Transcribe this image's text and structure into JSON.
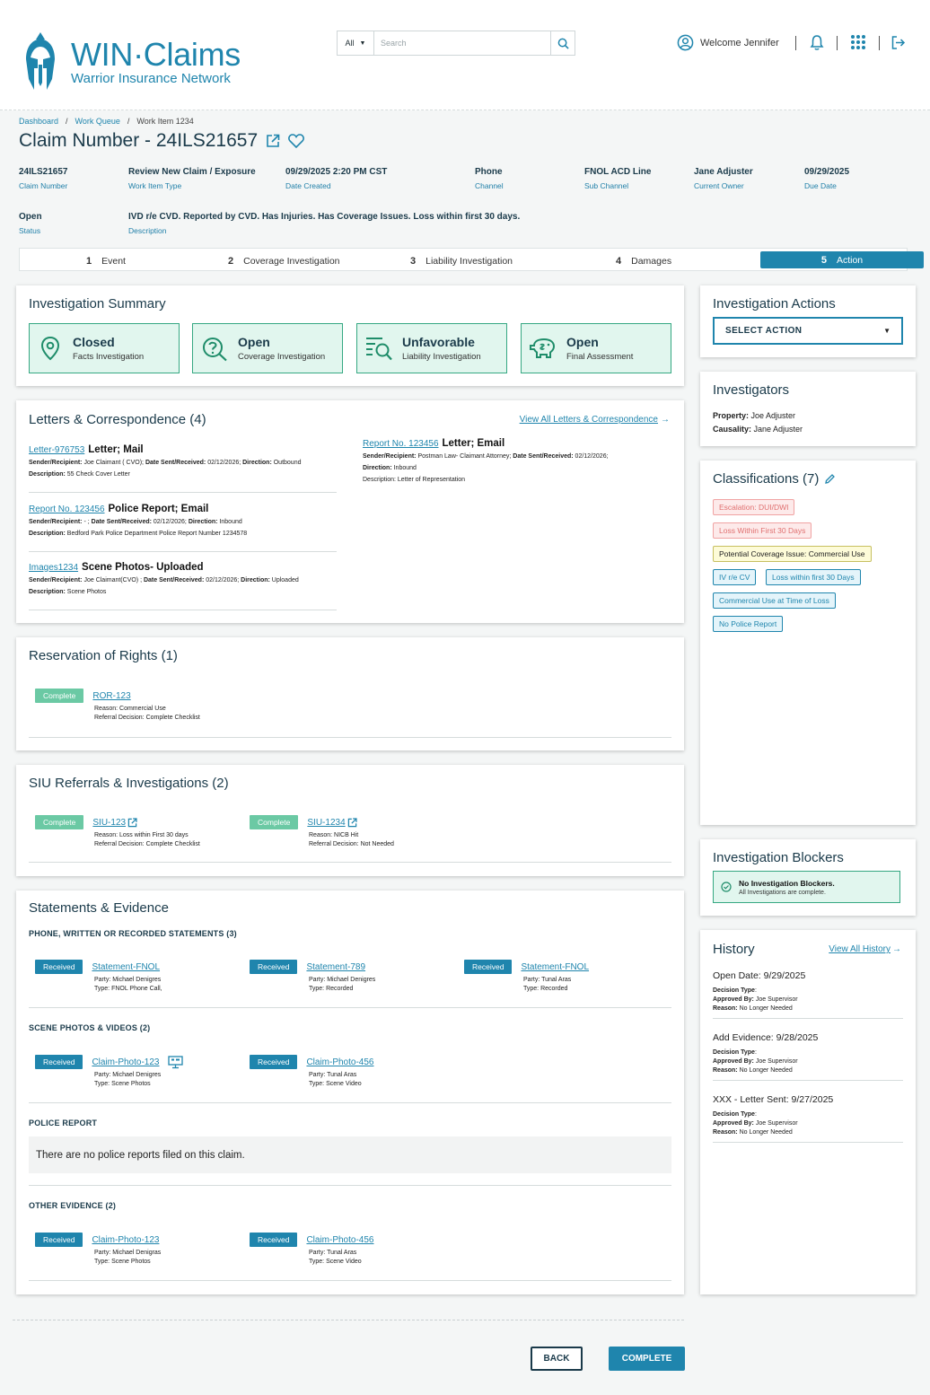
{
  "brand": {
    "title": "WIN·Claims",
    "subtitle": "Warrior Insurance Network"
  },
  "search": {
    "scope": "All",
    "placeholder": "Search"
  },
  "user": {
    "welcome": "Welcome Jennifer"
  },
  "breadcrumb": {
    "items": [
      "Dashboard",
      "Work Queue",
      "Work Item 1234"
    ]
  },
  "page": {
    "title": "Claim Number - 24ILS21657"
  },
  "meta": [
    {
      "value": "24ILS21657",
      "label": "Claim Number"
    },
    {
      "value": "Review New Claim / Exposure",
      "label": "Work Item Type"
    },
    {
      "value": "09/29/2025 2:20 PM CST",
      "label": "Date Created"
    },
    {
      "value": "Phone",
      "label": "Channel"
    },
    {
      "value": "FNOL ACD Line",
      "label": "Sub Channel"
    },
    {
      "value": "Jane Adjuster",
      "label": "Current Owner"
    },
    {
      "value": "09/29/2025",
      "label": "Due Date"
    },
    {
      "value": "Open",
      "label": "Status"
    },
    {
      "value": "IVD r/e CVD.  Reported by CVD. Has Injuries.  Has Coverage Issues.  Loss within first 30 days.",
      "label": "Description"
    }
  ],
  "steps": [
    {
      "num": "1",
      "label": "Event"
    },
    {
      "num": "2",
      "label": "Coverage Investigation"
    },
    {
      "num": "3",
      "label": "Liability  Investigation"
    },
    {
      "num": "4",
      "label": "Damages"
    },
    {
      "num": "5",
      "label": "Action"
    }
  ],
  "summary": {
    "title": "Investigation Summary",
    "boxes": [
      {
        "status": "Closed",
        "label": "Facts Investigation",
        "icon": "location-pin-icon"
      },
      {
        "status": "Open",
        "label": "Coverage Investigation",
        "icon": "question-search-icon"
      },
      {
        "status": "Unfavorable",
        "label": "Liability Investigation",
        "icon": "list-search-icon"
      },
      {
        "status": "Open",
        "label": "Final Assessment",
        "icon": "piggy-bank-icon"
      }
    ]
  },
  "letters": {
    "title": "Letters & Correspondence (4)",
    "view_all": "View All Letters & Correspondence",
    "items": [
      {
        "id": "Letter-976753",
        "title": "Letter; Mail",
        "line1_k1": "Sender/Recipient:",
        "line1_v1": " Joe Claimant ( CVO);  ",
        "line1_k2": "Date Sent/Received:",
        "line1_v2": " 02/12/2026;  ",
        "line1_k3": "Direction:",
        "line1_v3": " Outbound",
        "line2_k": "Description:",
        "line2_v": " 55 Check Cover Letter"
      },
      {
        "id": "Report No. 123456",
        "title": "Police Report; Email",
        "line1_k1": "Sender/Recipient:",
        "line1_v1": " - ;  ",
        "line1_k2": "Date Sent/Received:",
        "line1_v2": " 02/12/2026;  ",
        "line1_k3": "Direction:",
        "line1_v3": " Inbound",
        "line2_k": "Description:",
        "line2_v": " Bedford Park Police Department Police Report Number 1234578"
      },
      {
        "id": "Images1234",
        "title": "Scene Photos- Uploaded",
        "line1_k1": "Sender/Recipient:",
        "line1_v1": " Joe Claimant(CVO) ;  ",
        "line1_k2": "Date Sent/Received:",
        "line1_v2": " 02/12/2026;  ",
        "line1_k3": "Direction:",
        "line1_v3": " Uploaded",
        "line2_k": "Description:",
        "line2_v": " Scene Photos"
      },
      {
        "id": "Report No. 123456",
        "title": "Letter; Email",
        "line1_k1": "Sender/Recipient:",
        "line1_v1": " Postman Law- Claimant Attorney;  ",
        "line1_k2": "Date Sent/Received:",
        "line1_v2": " 02/12/2026;",
        "line3_k": "Direction:",
        "line3_v": " Inbound",
        "line2_k": "Description:",
        "line2_v": " Letter of Representation"
      }
    ]
  },
  "ror": {
    "title": "Reservation of Rights (1)",
    "items": [
      {
        "status": "Complete",
        "id": "ROR-123",
        "reason": "Reason: Commercial Use",
        "decision": "Referral Decision: Complete Checklist"
      }
    ]
  },
  "siu": {
    "title": "SIU Referrals & Investigations (2)",
    "items": [
      {
        "status": "Complete",
        "id": "SIU-123",
        "reason": "Reason: Loss within First 30 days",
        "decision": "Referral Decision: Complete Checklist"
      },
      {
        "status": "Complete",
        "id": "SIU-1234",
        "reason": "Reason: NICB Hit",
        "decision": "Referral Decision: Not Needed"
      }
    ]
  },
  "evidence": {
    "title": "Statements & Evidence",
    "statements_h": "PHONE, WRITTEN OR RECORDED STATEMENTS (3)",
    "statements": [
      {
        "status": "Received",
        "id": "Statement-FNOL",
        "party": "Party: Michael Denigres",
        "type": "Type: FNOL Phone Call,"
      },
      {
        "status": "Received",
        "id": "Statement-789",
        "party": "Party: Michael Denigres",
        "type": "Type: Recorded"
      },
      {
        "status": "Received",
        "id": "Statement-FNOL",
        "party": "Party: Tunal Aras",
        "type": "Type: Recorded"
      }
    ],
    "photos_h": "SCENE PHOTOS & VIDEOS  (2)",
    "photos": [
      {
        "status": "Received",
        "id": "Claim-Photo-123",
        "party": "Party: Michael Denigres",
        "type": "Type: Scene Photos"
      },
      {
        "status": "Received",
        "id": "Claim-Photo-456",
        "party": "Party: Tunal Aras",
        "type": "Type: Scene Video"
      }
    ],
    "police_h": "POLICE REPORT",
    "police_empty": "There are no police reports filed on this claim.",
    "other_h": "OTHER EVIDENCE (2)",
    "other": [
      {
        "status": "Received",
        "id": "Claim-Photo-123",
        "party": "Party: Michael Denigras",
        "type": "Type: Scene Photos"
      },
      {
        "status": "Received",
        "id": "Claim-Photo-456",
        "party": "Party: Tunal Aras",
        "type": "Type: Scene Video"
      }
    ]
  },
  "actions": {
    "title": "Investigation Actions",
    "select": "SELECT  ACTION"
  },
  "investigators": {
    "title": "Investigators",
    "rows": [
      {
        "k": "Property:",
        "v": " Joe Adjuster"
      },
      {
        "k": "Causality:",
        "v": " Jane Adjuster"
      }
    ]
  },
  "classifications": {
    "title": "Classifications (7)",
    "tags": [
      "Escalation: DUI/DWI",
      "Loss Within First 30 Days",
      "Potential Coverage Issue: Commercial Use",
      "IV r/e CV",
      "Loss within first 30 Days",
      "Commercial Use at Time of Loss",
      "No Police Report"
    ]
  },
  "blockers": {
    "title": "Investigation Blockers",
    "msg": "No  Investigation Blockers.",
    "sub": "All Investigations are complete."
  },
  "history": {
    "title": "History",
    "view_all": "View All History",
    "entries": [
      {
        "head": "Open Date: 9/29/2025",
        "dt": "Decision Type",
        "ab_k": "Approved By:",
        "ab_v": " Joe Supervisor",
        "r_k": "Reason:",
        "r_v": " No Longer Needed"
      },
      {
        "head": "Add Evidence: 9/28/2025",
        "dt": "Decision Type",
        "ab_k": "Approved By:",
        "ab_v": " Joe Supervisor",
        "r_k": "Reason:",
        "r_v": " No Longer Needed"
      },
      {
        "head": "XXX - Letter Sent: 9/27/2025",
        "dt": "Decision Type",
        "ab_k": "Approved By:",
        "ab_v": " Joe Supervisor",
        "r_k": "Reason:",
        "r_v": " No Longer Needed"
      }
    ]
  },
  "footer": {
    "back": "BACK",
    "complete": "COMPLETE"
  },
  "colors": {
    "brand": "#1f85ad",
    "success_border": "#35a882",
    "success_bg": "#e1f6ee"
  }
}
